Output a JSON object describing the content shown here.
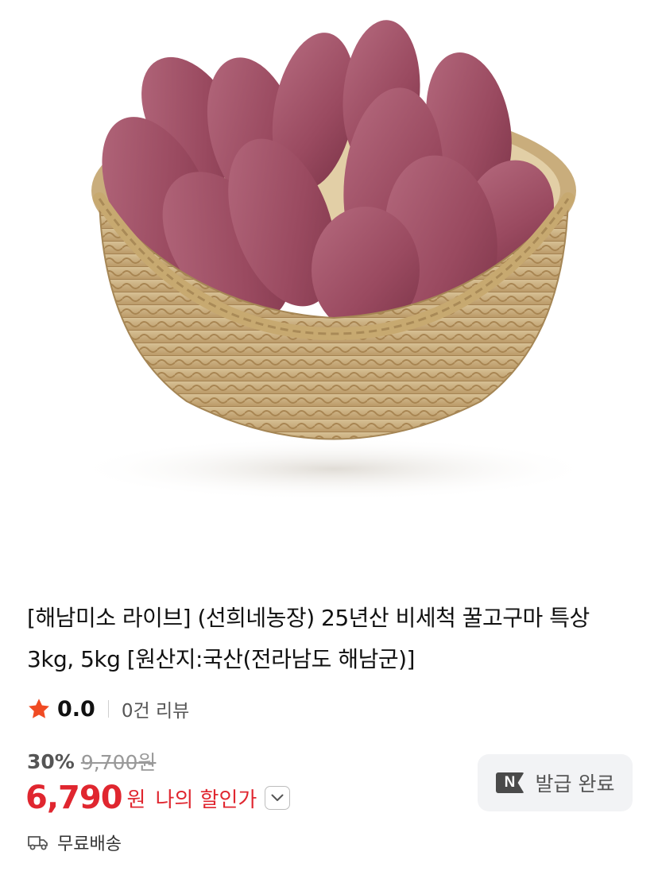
{
  "product": {
    "image_alt": "basket of sweet potatoes",
    "title": "[해남미소 라이브] (선희네농장) 25년산 비세척 꿀고구마 특상 3kg, 5kg [원산지:국산(전라남도 해남군)]"
  },
  "rating": {
    "value": "0.0",
    "review_count": "0건 리뷰",
    "star_color": "#f04b23"
  },
  "pricing": {
    "discount_rate": "30%",
    "original_price": "9,700원",
    "sale_price": "6,790",
    "currency": "원",
    "my_discount_label": "나의 할인가",
    "accent_color": "#e0262f"
  },
  "coupon": {
    "icon_text": "N",
    "label": "발급 완료"
  },
  "shipping": {
    "label": "무료배송",
    "icon": "truck-icon"
  }
}
